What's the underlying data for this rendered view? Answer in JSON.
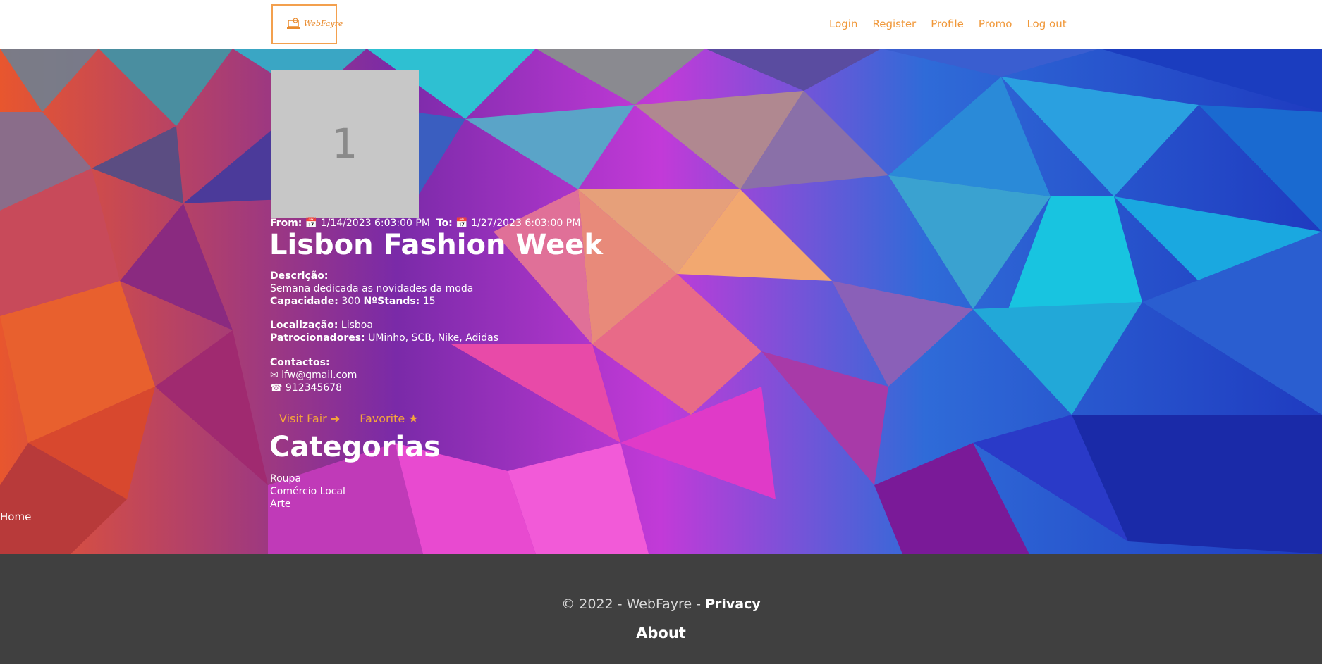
{
  "nav": {
    "logo_text": "WebFayre",
    "links": [
      "Login",
      "Register",
      "Profile",
      "Promo",
      "Log out"
    ]
  },
  "fair": {
    "thumbnail_label": "1",
    "from_label": "From:",
    "from_date": "1/14/2023 6:03:00 PM",
    "to_label": "To:",
    "to_date": "1/27/2023 6:03:00 PM",
    "title": "Lisbon Fashion Week",
    "description_label": "Descrição:",
    "description": "Semana dedicada as novidades da moda",
    "capacity_label": "Capacidade:",
    "capacity": "300",
    "stands_label": "NºStands:",
    "stands": "15",
    "location_label": "Localização:",
    "location": "Lisboa",
    "sponsors_label": "Patrocionadores:",
    "sponsors": "UMinho, SCB, Nike, Adidas",
    "contacts_label": "Contactos:",
    "email": "lfw@gmail.com",
    "phone": "912345678"
  },
  "actions": {
    "visit_label": "Visit Fair",
    "favorite_label": "Favorite"
  },
  "categories": {
    "title": "Categorias",
    "items": [
      "Roupa",
      "Comércio Local",
      "Arte"
    ]
  },
  "breadcrumb": {
    "home": "Home"
  },
  "footer": {
    "copyright": "© 2022 - WebFayre -",
    "privacy": "Privacy",
    "about": "About"
  },
  "colors": {
    "accent": "#f0983a",
    "footer_bg": "#404040",
    "thumb_bg": "#c7c7c7"
  }
}
